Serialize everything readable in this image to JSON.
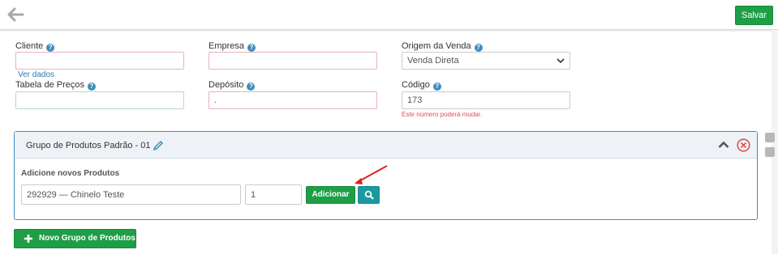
{
  "topbar": {
    "save_label": "Salvar"
  },
  "form": {
    "cliente": {
      "label": "Cliente",
      "value": "",
      "link": "Ver dados"
    },
    "empresa": {
      "label": "Empresa",
      "value": ""
    },
    "origem": {
      "label": "Origem da Venda",
      "value": "Venda Direta"
    },
    "tabela": {
      "label": "Tabela de Preços",
      "value": ""
    },
    "deposito": {
      "label": "Depósito",
      "value": "."
    },
    "codigo": {
      "label": "Código",
      "value": "173",
      "warning": "Este número poderá mudar."
    }
  },
  "group": {
    "title": "Grupo de Produtos Padrão - 01",
    "add_label": "Adicione novos Produtos",
    "product_value": "292929 — Chinelo Teste",
    "quantity_value": "1",
    "add_button": "Adicionar"
  },
  "new_group_button": "Novo Grupo de Produtos",
  "colors": {
    "primary": "#1e9e46",
    "accent": "#3c8dbc",
    "search": "#1a9aa0",
    "danger": "#d9534f"
  },
  "icons": {
    "back": "arrow-left-icon",
    "help": "question-circle-icon",
    "edit": "pencil-icon",
    "collapse": "chevron-up-icon",
    "remove": "close-circle-icon",
    "search": "search-icon",
    "add": "plus-icon"
  }
}
